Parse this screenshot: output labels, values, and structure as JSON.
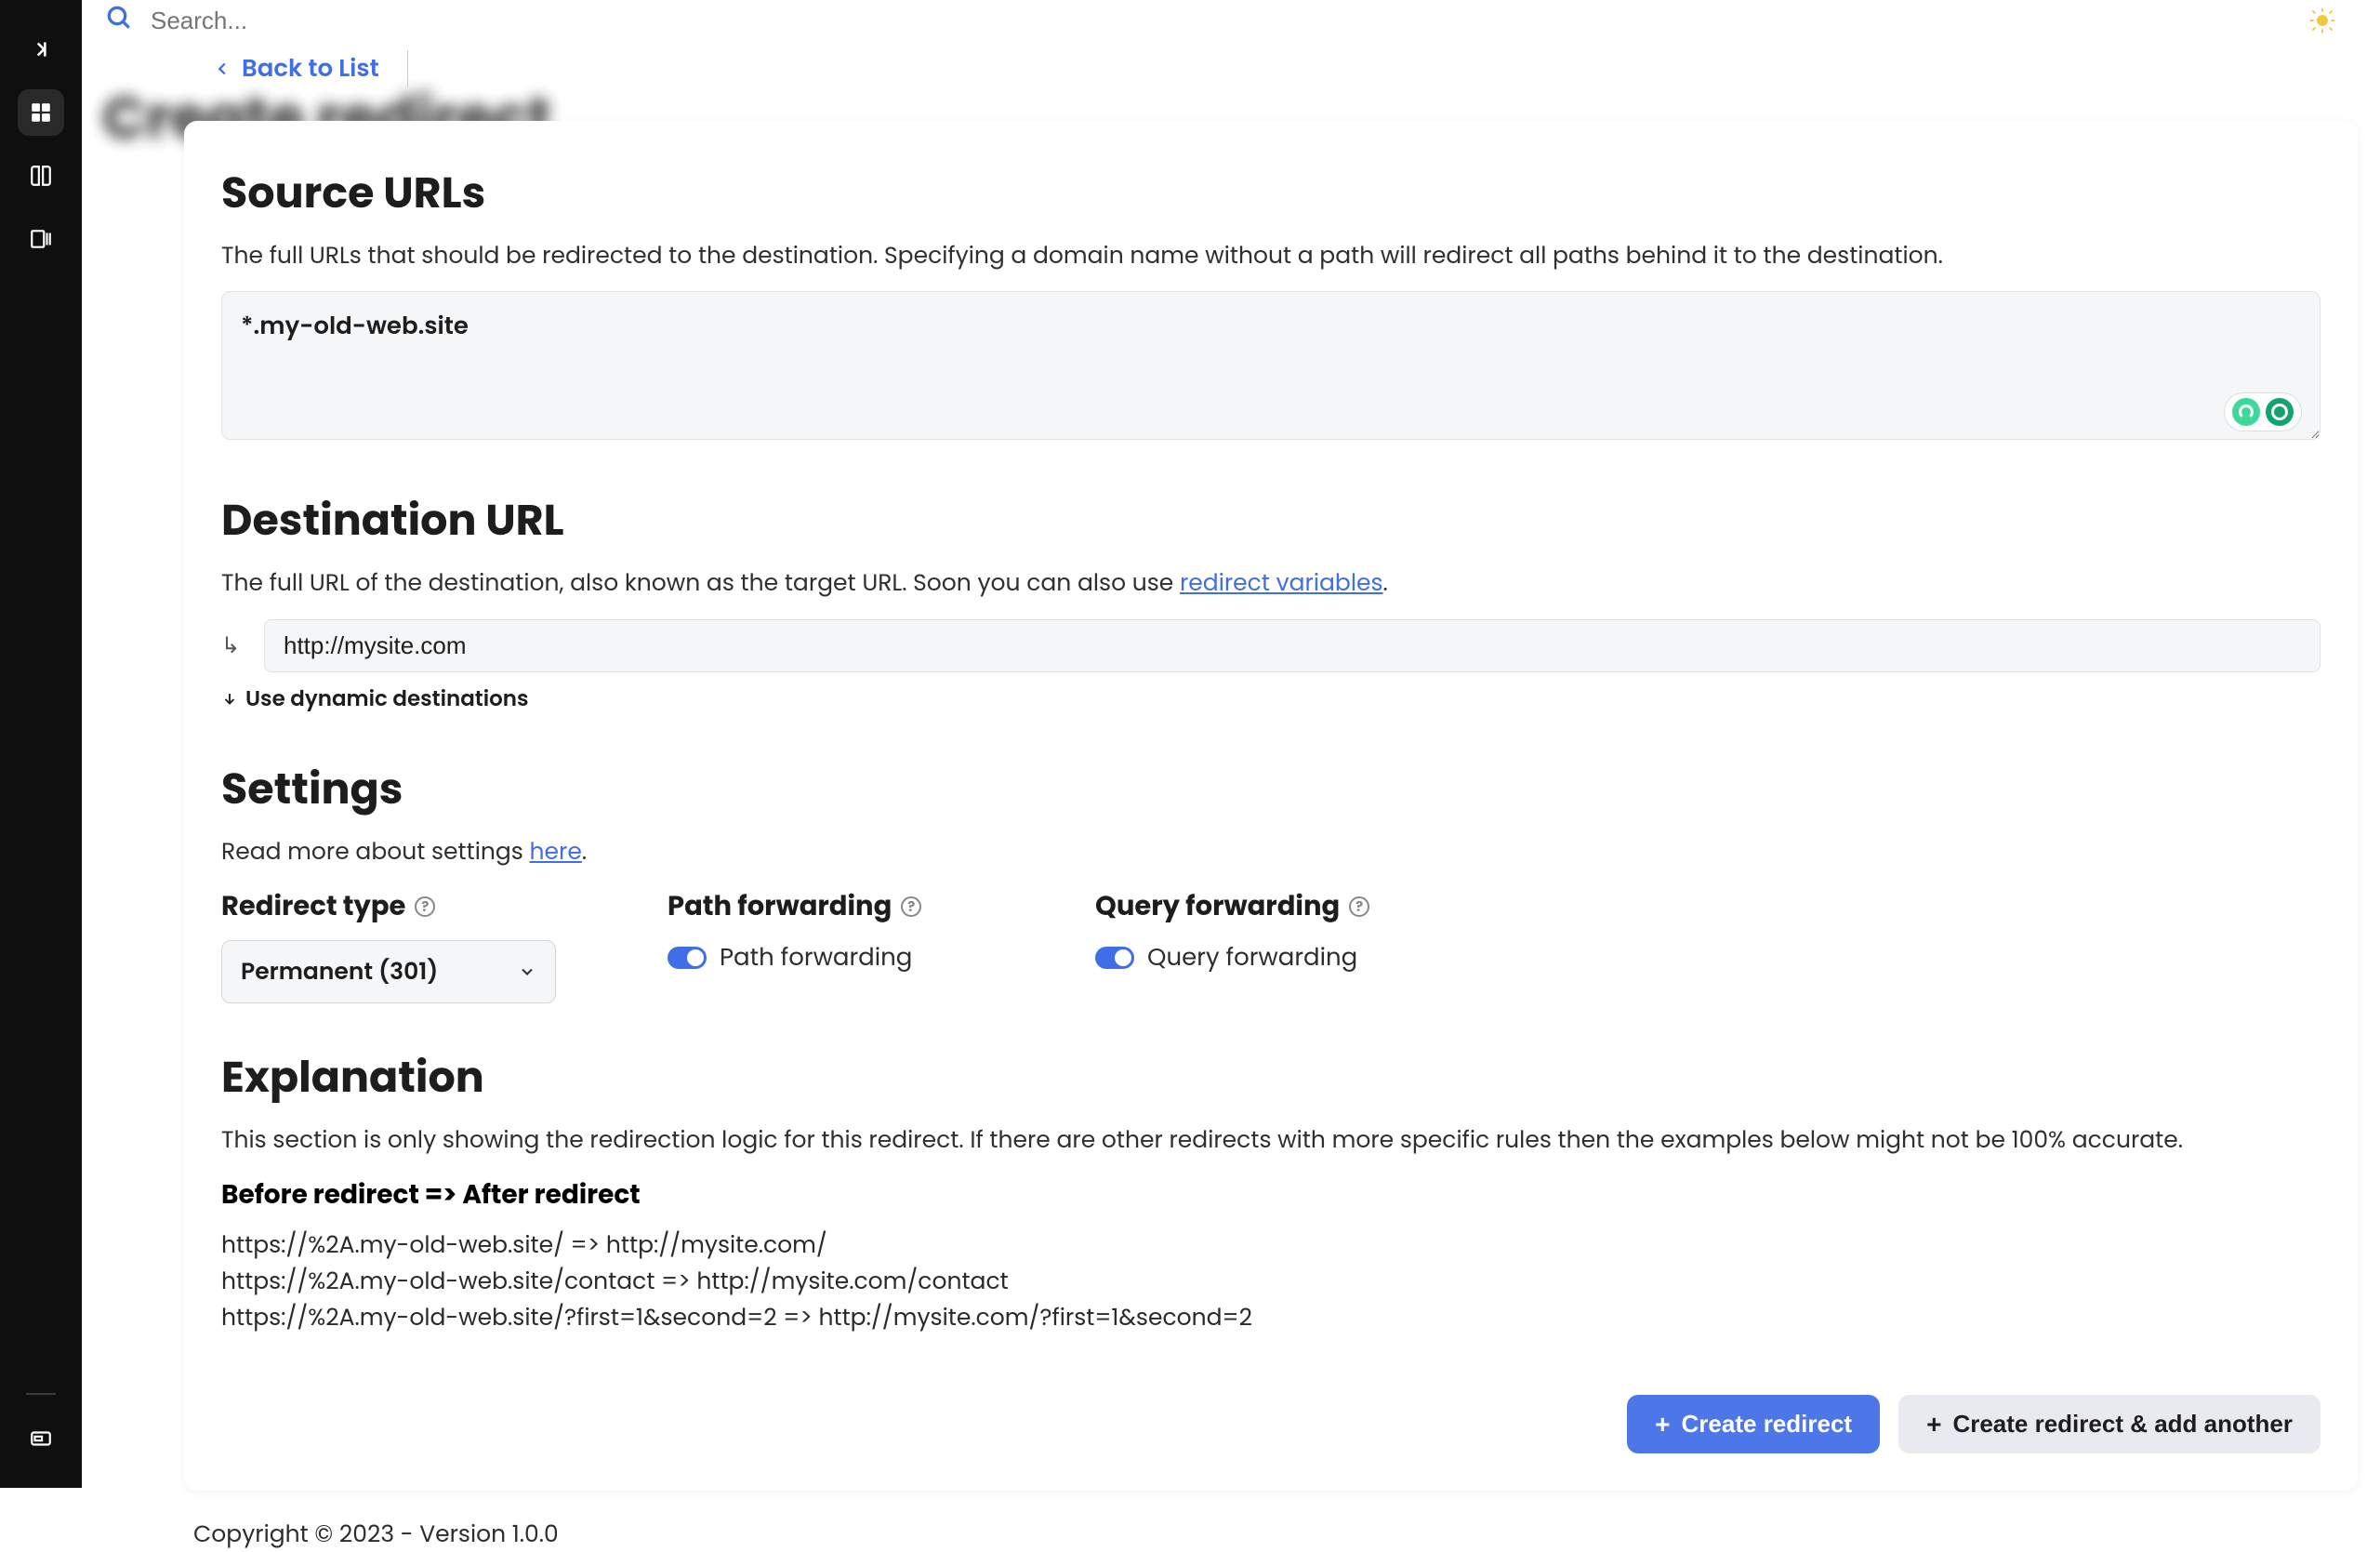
{
  "search": {
    "placeholder": "Search..."
  },
  "page_title_blurred": "Create redirect",
  "back_link": "Back to List",
  "sections": {
    "source": {
      "title": "Source URLs",
      "desc": "The full URLs that should be redirected to the destination. Specifying a domain name without a path will redirect all paths behind it to the destination.",
      "value": "*.my-old-web.site"
    },
    "destination": {
      "title": "Destination URL",
      "desc_pre": "The full URL of the destination, also known as the target URL. Soon you can also use ",
      "desc_link": "redirect variables",
      "desc_post": ".",
      "value": "http://mysite.com",
      "dynamic_label": "Use dynamic destinations"
    },
    "settings": {
      "title": "Settings",
      "desc_pre": "Read more about settings ",
      "desc_link": "here",
      "desc_post": ".",
      "redirect_type": {
        "label": "Redirect type",
        "value": "Permanent (301)"
      },
      "path_forwarding": {
        "label": "Path forwarding",
        "toggle_label": "Path forwarding",
        "on": true
      },
      "query_forwarding": {
        "label": "Query forwarding",
        "toggle_label": "Query forwarding",
        "on": true
      }
    },
    "explanation": {
      "title": "Explanation",
      "desc": "This section is only showing the redirection logic for this redirect. If there are other redirects with more specific rules then the examples below might not be 100% accurate.",
      "sub": "Before redirect => After redirect",
      "lines": [
        "https://%2A.my-old-web.site/ => http://mysite.com/",
        "https://%2A.my-old-web.site/contact => http://mysite.com/contact",
        "https://%2A.my-old-web.site/?first=1&second=2 => http://mysite.com/?first=1&second=2"
      ]
    }
  },
  "buttons": {
    "create": "Create redirect",
    "create_another": "Create redirect & add another"
  },
  "footer": "Copyright © 2023 - Version 1.0.0"
}
